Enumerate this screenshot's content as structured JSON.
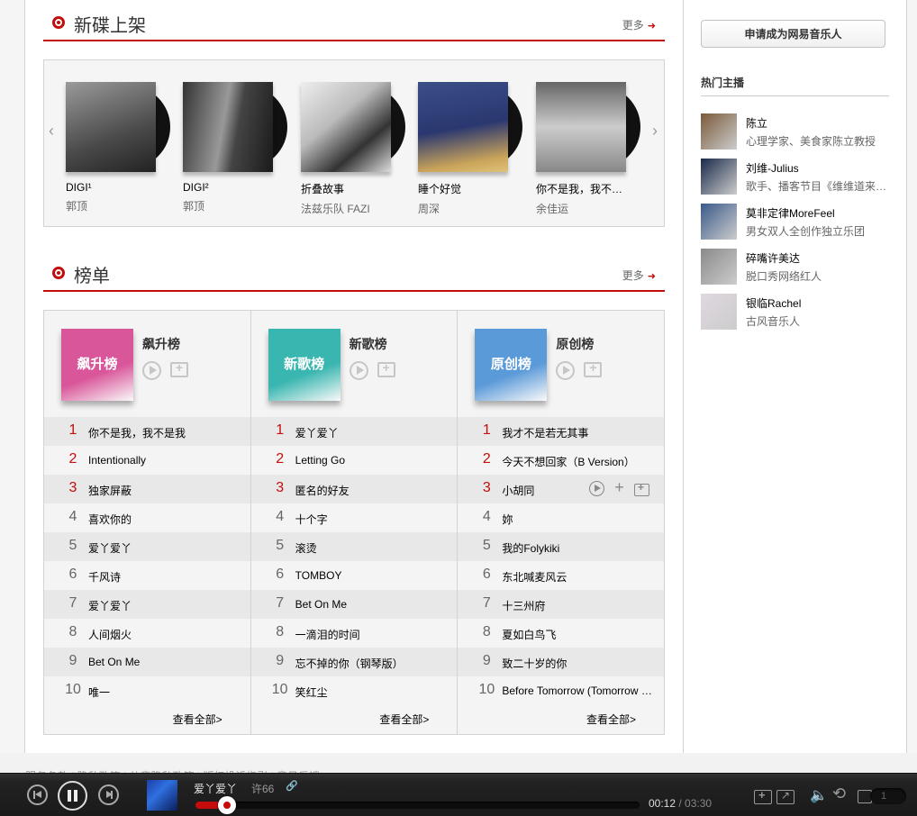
{
  "new_albums": {
    "title": "新碟上架",
    "more": "更多",
    "albums": [
      {
        "name": "DIGI¹",
        "artist": "郭顶"
      },
      {
        "name": "DIGI²",
        "artist": "郭顶"
      },
      {
        "name": "折叠故事",
        "artist": "法兹乐队 FAZI"
      },
      {
        "name": "睡个好觉",
        "artist": "周深"
      },
      {
        "name": "你不是我，我不是我",
        "artist": "余佳运"
      }
    ]
  },
  "charts": {
    "title": "榜单",
    "more": "更多",
    "view_all": "查看全部>",
    "lists": [
      {
        "name": "飙升榜",
        "thumb_text": "飙升榜",
        "color": "#d9569a",
        "songs": [
          "你不是我，我不是我",
          "Intentionally",
          "独家屏蔽",
          "喜欢你的",
          "爱丫爱丫",
          "千风诗",
          "爱丫爱丫",
          "人间烟火",
          "Bet On Me",
          "唯一"
        ]
      },
      {
        "name": "新歌榜",
        "thumb_text": "新歌榜",
        "color": "#3ab6b0",
        "songs": [
          "爱丫爱丫",
          "Letting Go",
          "匿名的好友",
          "十个字",
          "滚烫",
          "TOMBOY",
          "Bet On Me",
          "一滴泪的时间",
          "忘不掉的你（钢琴版）",
          "笑红尘"
        ]
      },
      {
        "name": "原创榜",
        "thumb_text": "原创榜",
        "color": "#5b9ad8",
        "songs": [
          "我才不是若无其事",
          "今天不想回家（B Version）",
          "小胡同",
          "妳",
          "我的Folykiki",
          "东北喊麦风云",
          "十三州府",
          "夏如白鸟飞",
          "致二十岁的你",
          "Before Tomorrow (Tomorrow Never Dies)"
        ]
      }
    ]
  },
  "sidebar": {
    "apply_button": "申请成为网易音乐人",
    "hot_dj_title": "热门主播",
    "djs": [
      {
        "name": "陈立",
        "desc": "心理学家、美食家陈立教授"
      },
      {
        "name": "刘维-Julius",
        "desc": "歌手、播客节目《维维道来》主理人"
      },
      {
        "name": "莫非定律MoreFeel",
        "desc": "男女双人全创作独立乐团"
      },
      {
        "name": "碎嘴许美达",
        "desc": "脱口秀网络红人"
      },
      {
        "name": "银临Rachel",
        "desc": "古风音乐人"
      }
    ]
  },
  "footer": {
    "links": "服务条款 | 隐私政策 | 儿童隐私政策 | 版权投诉指引 | 意见反馈"
  },
  "player": {
    "song": "爱丫爱丫",
    "artist": "许66",
    "current_time": "00:12",
    "total_time": "/ 03:30",
    "progress": 0.057,
    "queue_count": "1"
  }
}
